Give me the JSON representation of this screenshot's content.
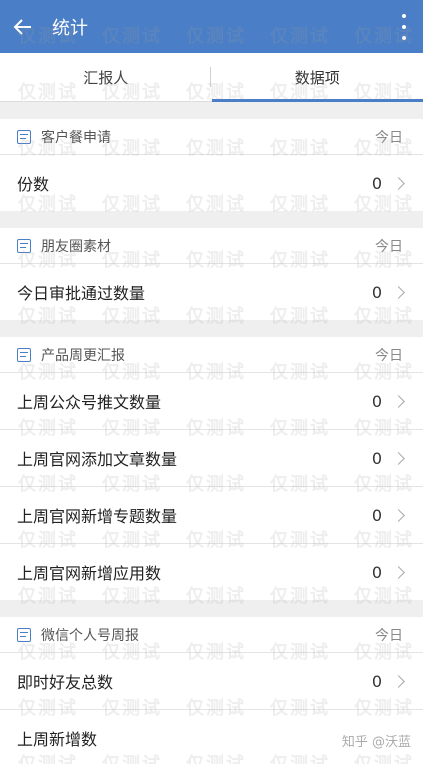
{
  "appbar": {
    "title": "统计"
  },
  "tabs": [
    {
      "label": "汇报人",
      "active": false
    },
    {
      "label": "数据项",
      "active": true
    }
  ],
  "sections": [
    {
      "title": "客户餐申请",
      "date": "今日",
      "rows": [
        {
          "label": "份数",
          "value": "0"
        }
      ]
    },
    {
      "title": "朋友圈素材",
      "date": "今日",
      "rows": [
        {
          "label": "今日审批通过数量",
          "value": "0"
        }
      ]
    },
    {
      "title": "产品周更汇报",
      "date": "今日",
      "rows": [
        {
          "label": "上周公众号推文数量",
          "value": "0"
        },
        {
          "label": "上周官网添加文章数量",
          "value": "0"
        },
        {
          "label": "上周官网新增专题数量",
          "value": "0"
        },
        {
          "label": "上周官网新增应用数",
          "value": "0"
        }
      ]
    },
    {
      "title": "微信个人号周报",
      "date": "今日",
      "rows": [
        {
          "label": "即时好友总数",
          "value": "0"
        },
        {
          "label": "上周新增数",
          "value": ""
        }
      ]
    }
  ],
  "watermark": {
    "text": "仅测试"
  },
  "credit": "知乎 @沃蓝",
  "colors": {
    "appbar": "#4a7ec6",
    "background": "#efefef"
  }
}
